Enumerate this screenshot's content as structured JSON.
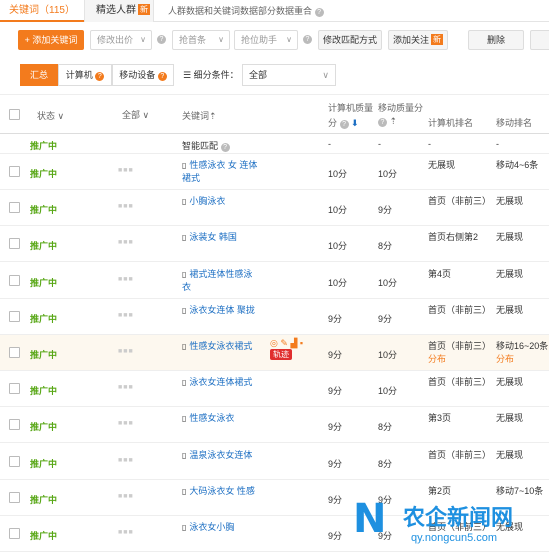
{
  "tabs": {
    "keywords": "关键词（115）",
    "crowd": "精选人群",
    "crowd_badge": "新",
    "merge_note": "人群数据和关键词数据部分数据重合"
  },
  "toolbar": {
    "add_keyword": "+ 添加关键词",
    "modify_bid": "修改出价",
    "grab_top": "抢首条",
    "grab_assist": "抢位助手",
    "modify_match": "修改匹配方式",
    "add_follow": "添加关注",
    "add_follow_badge": "新",
    "delete": "删除"
  },
  "filters": {
    "summary": "汇总",
    "computer": "计算机",
    "mobile": "移动设备",
    "condition_label": "细分条件：",
    "condition_value": "全部"
  },
  "table": {
    "headers": {
      "status": "状态",
      "all": "全部",
      "keyword": "关键词",
      "pc_quality_1": "计算机质量",
      "pc_quality_2": "分",
      "mobile_quality": "移动质量分",
      "pc_rank": "计算机排名",
      "mobile_rank": "移动排名"
    },
    "smart_row": {
      "status": "推广中",
      "keyword": "智能匹配",
      "pc_quality": "-",
      "mobile_quality": "-",
      "pc_rank": "-",
      "mobile_rank": "-"
    },
    "rows": [
      {
        "status": "推广中",
        "keyword": "性感泳衣 女 连体 裙式",
        "pc_quality": "10分",
        "mobile_quality": "10分",
        "pc_rank": "无展现",
        "pc_rank2": "",
        "mobile_rank": "移动4~6条",
        "mobile_rank2": ""
      },
      {
        "status": "推广中",
        "keyword": "小胸泳衣",
        "pc_quality": "10分",
        "mobile_quality": "9分",
        "pc_rank": "首页（非前三）",
        "pc_rank2": "",
        "mobile_rank": "无展现",
        "mobile_rank2": ""
      },
      {
        "status": "推广中",
        "keyword": "泳装女 韩国",
        "pc_quality": "10分",
        "mobile_quality": "8分",
        "pc_rank": "首页右侧第2",
        "pc_rank2": "",
        "mobile_rank": "无展现",
        "mobile_rank2": ""
      },
      {
        "status": "推广中",
        "keyword": "裙式连体性感泳衣",
        "pc_quality": "10分",
        "mobile_quality": "10分",
        "pc_rank": "第4页",
        "pc_rank2": "",
        "mobile_rank": "无展现",
        "mobile_rank2": ""
      },
      {
        "status": "推广中",
        "keyword": "泳衣女连体 聚拢",
        "pc_quality": "9分",
        "mobile_quality": "9分",
        "pc_rank": "首页（非前三）",
        "pc_rank2": "",
        "mobile_rank": "无展现",
        "mobile_rank2": ""
      },
      {
        "status": "推广中",
        "keyword": "性感女泳衣裙式",
        "pc_quality": "9分",
        "mobile_quality": "10分",
        "pc_rank": "首页（非前三）",
        "pc_rank2": "分布",
        "mobile_rank": "移动16~20条",
        "mobile_rank2": "分布"
      },
      {
        "status": "推广中",
        "keyword": "泳衣女连体裙式",
        "pc_quality": "9分",
        "mobile_quality": "10分",
        "pc_rank": "首页（非前三）",
        "pc_rank2": "",
        "mobile_rank": "无展现",
        "mobile_rank2": ""
      },
      {
        "status": "推广中",
        "keyword": "性感女泳衣",
        "pc_quality": "9分",
        "mobile_quality": "8分",
        "pc_rank": "第3页",
        "pc_rank2": "",
        "mobile_rank": "无展现",
        "mobile_rank2": ""
      },
      {
        "status": "推广中",
        "keyword": "温泉泳衣女连体",
        "pc_quality": "9分",
        "mobile_quality": "8分",
        "pc_rank": "首页（非前三）",
        "pc_rank2": "",
        "mobile_rank": "无展现",
        "mobile_rank2": ""
      },
      {
        "status": "推广中",
        "keyword": "大码泳衣女 性感",
        "pc_quality": "9分",
        "mobile_quality": "9分",
        "pc_rank": "第2页",
        "pc_rank2": "",
        "mobile_rank": "移动7~10条",
        "mobile_rank2": ""
      },
      {
        "status": "推广中",
        "keyword": "泳衣女小胸",
        "pc_quality": "9分",
        "mobile_quality": "9分",
        "pc_rank": "首页（非前三）",
        "pc_rank2": "",
        "mobile_rank": "无展现",
        "mobile_rank2": ""
      }
    ],
    "trace_label": "轨迹"
  },
  "watermark": {
    "title": "农企新闻网",
    "url": "qy.nongcun5.com"
  }
}
